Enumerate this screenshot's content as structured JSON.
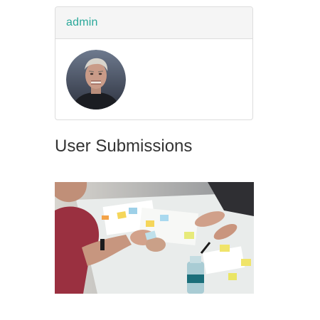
{
  "user_card": {
    "username": "admin",
    "avatar_icon": "user-avatar-photo"
  },
  "submissions": {
    "title": "User Submissions",
    "items": [
      {
        "image": "team-meeting-sticky-notes-photo"
      }
    ]
  },
  "colors": {
    "accent": "#2aa89a",
    "heading_text": "#333333",
    "card_header_bg": "#f5f5f5",
    "card_border": "#dddddd"
  }
}
